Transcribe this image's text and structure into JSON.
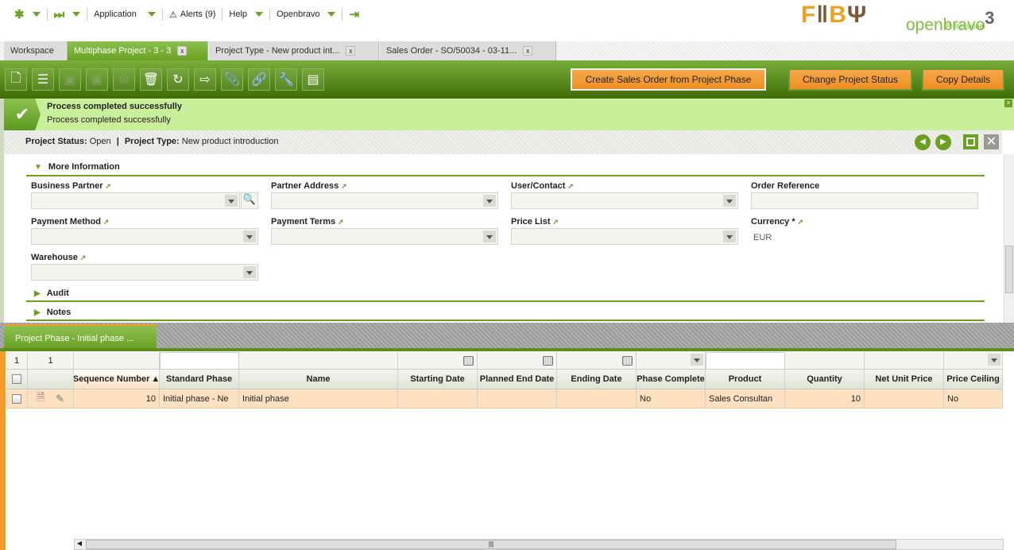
{
  "nav": {
    "application": "Application",
    "alerts": "Alerts (9)",
    "help": "Help",
    "user": "Openbravo"
  },
  "logos": {
    "client": "F+B",
    "brand": "openbravo",
    "edition": "Professional",
    "version": "3"
  },
  "tabs": [
    {
      "label": "Workspace"
    },
    {
      "label": "Multiphase Project - 3 - 3",
      "close": "x"
    },
    {
      "label": "Project Type - New product int...",
      "close": "x"
    },
    {
      "label": "Sales Order - SO/50034 - 03-11...",
      "close": "x"
    }
  ],
  "toolbar": {
    "buttons": {
      "create_so": "Create Sales Order from Project Phase",
      "change_status": "Change Project Status",
      "copy_details": "Copy Details"
    }
  },
  "message": {
    "title": "Process completed successfully",
    "text": "Process completed successfully"
  },
  "status": {
    "status_label": "Project Status:",
    "status_value": "Open",
    "sep": "|",
    "type_label": "Project Type:",
    "type_value": "New product introduction"
  },
  "form": {
    "more_info": "More Information",
    "audit": "Audit",
    "notes": "Notes",
    "fields": {
      "business_partner": "Business Partner",
      "partner_address": "Partner Address",
      "user_contact": "User/Contact",
      "order_reference": "Order Reference",
      "payment_method": "Payment Method",
      "payment_terms": "Payment Terms",
      "price_list": "Price List",
      "currency": "Currency *",
      "currency_value": "EUR",
      "warehouse": "Warehouse"
    }
  },
  "subtab": {
    "label": "Project Phase - Initial phase ..."
  },
  "grid": {
    "counts": [
      "1",
      "1"
    ],
    "columns": [
      "Sequence Number",
      "Standard Phase",
      "Name",
      "Starting Date",
      "Planned End Date",
      "Ending Date",
      "Phase Complete",
      "Product",
      "Quantity",
      "Net Unit Price",
      "Price Ceiling"
    ],
    "sort_indicator": "▲",
    "rows": [
      {
        "seq": "10",
        "std": "Initial phase - Ne",
        "name": "Initial phase",
        "start": "",
        "planned": "",
        "ending": "",
        "complete": "No",
        "product": "Sales Consultan",
        "qty": "10",
        "net": "",
        "ceiling": "No"
      }
    ]
  },
  "colors": {
    "green": "#6aa121",
    "orange": "#ee8f23",
    "message_bg": "#c9ef9a",
    "row_bg": "#fde0c0"
  }
}
